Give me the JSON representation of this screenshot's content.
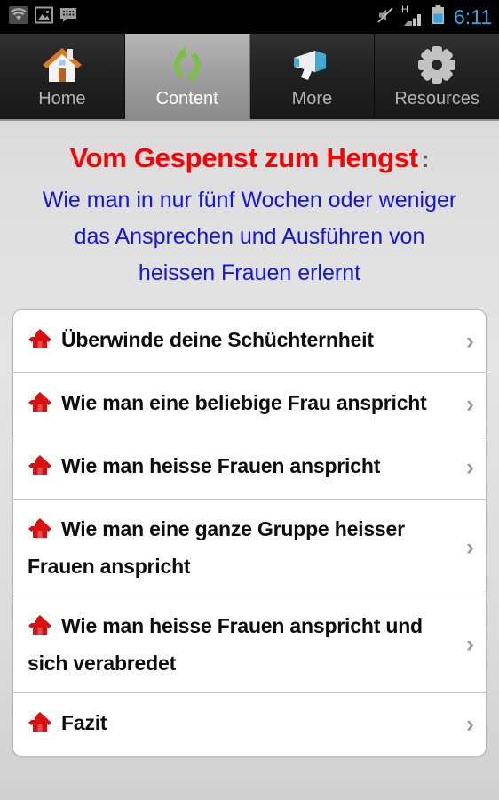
{
  "statusbar": {
    "icons_left": [
      "wifi-icon",
      "gallery-icon",
      "message-icon"
    ],
    "icons_right": [
      "mute-icon",
      "signal-h-icon",
      "battery-icon"
    ],
    "signal_label": "H",
    "clock": "6:11",
    "clock_color": "#2ea7e0"
  },
  "tabs": [
    {
      "label": "Home",
      "icon": "house-icon",
      "active": false
    },
    {
      "label": "Content",
      "icon": "refresh-icon",
      "active": true
    },
    {
      "label": "More",
      "icon": "megaphone-icon",
      "active": false
    },
    {
      "label": "Resources",
      "icon": "gear-icon",
      "active": false
    }
  ],
  "header": {
    "title": "Vom Gespenst zum Hengst",
    "title_color": "#fe0000",
    "colon": ":",
    "subtitle_lines": [
      "Wie man in nur fünf Wochen oder weniger",
      "das Ansprechen und Ausführen von",
      "heissen Frauen erlernt"
    ],
    "subtitle_color": "#1414e6"
  },
  "list": {
    "items": [
      {
        "label": "Überwinde deine Schüchternheit",
        "icon": "house-icon",
        "chevron": "›"
      },
      {
        "label": "Wie man eine beliebige Frau anspricht",
        "icon": "house-icon",
        "chevron": "›"
      },
      {
        "label": "Wie man heisse Frauen anspricht",
        "icon": "house-icon",
        "chevron": "›"
      },
      {
        "label": "Wie man eine ganze Gruppe heisser Frauen anspricht",
        "icon": "house-icon",
        "chevron": "›"
      },
      {
        "label": "Wie man heisse Frauen anspricht und sich verabredet",
        "icon": "house-icon",
        "chevron": "›"
      },
      {
        "label": "Fazit",
        "icon": "house-icon",
        "chevron": "›"
      }
    ]
  }
}
